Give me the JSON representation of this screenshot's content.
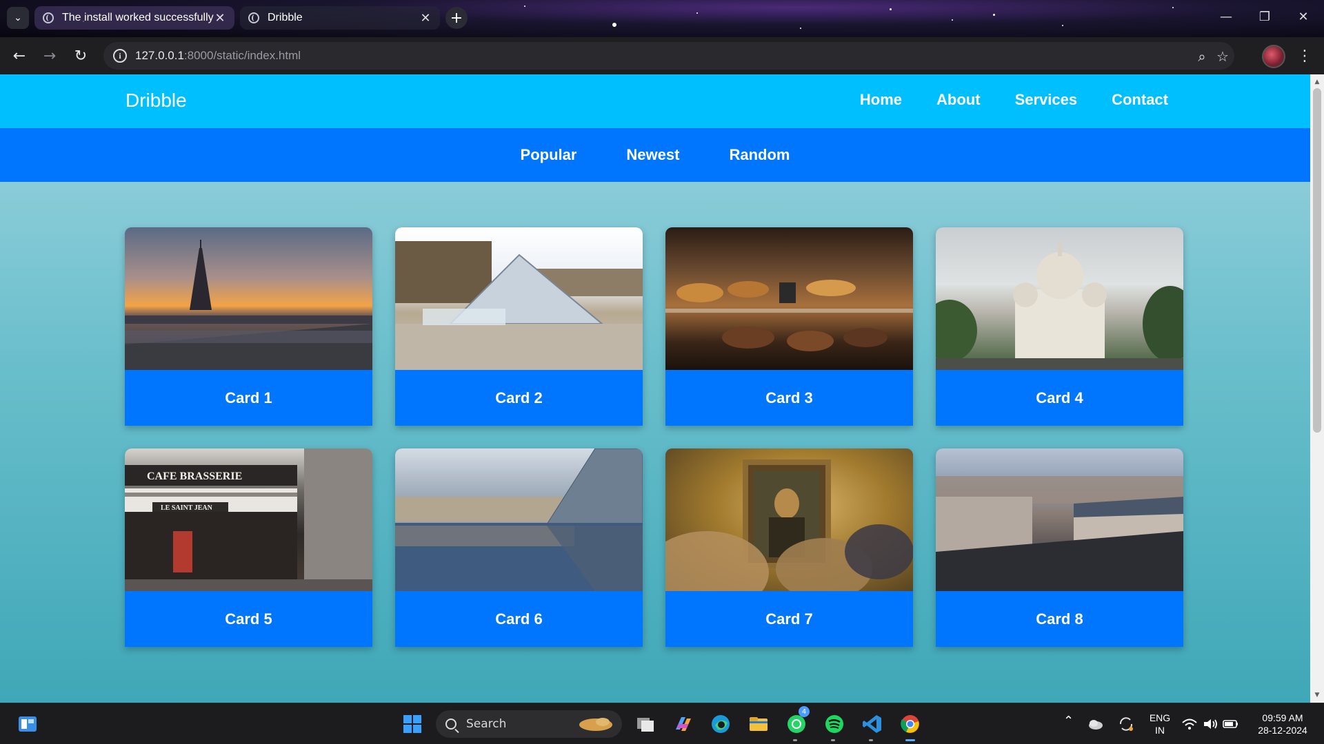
{
  "browser": {
    "tabs": [
      {
        "title": "The install worked successfully!",
        "close": "✕"
      },
      {
        "title": "Dribble",
        "close": "✕"
      }
    ],
    "new_tab": "+",
    "tab_menu": "⌄",
    "window": {
      "minimize": "—",
      "restore": "❐",
      "close": "✕"
    },
    "address": {
      "host": "127.0.0.1",
      "rest": ":8000/static/index.html"
    },
    "nav": {
      "back": "←",
      "forward": "→",
      "reload": "↻"
    },
    "zoom_icon": "⌕",
    "bookmark_icon": "☆",
    "menu_icon": "⋮"
  },
  "site": {
    "brand": "Dribble",
    "nav": [
      "Home",
      "About",
      "Services",
      "Contact"
    ],
    "subnav": [
      "Popular",
      "Newest",
      "Random"
    ],
    "cards": [
      {
        "label": "Card 1",
        "subject": "eiffel-tower-sunset"
      },
      {
        "label": "Card 2",
        "subject": "louvre-pyramid"
      },
      {
        "label": "Card 3",
        "subject": "bakery-pastries"
      },
      {
        "label": "Card 4",
        "subject": "sacre-coeur"
      },
      {
        "label": "Card 5",
        "subject": "cafe-brasserie"
      },
      {
        "label": "Card 6",
        "subject": "louvre-reflection"
      },
      {
        "label": "Card 7",
        "subject": "mona-lisa"
      },
      {
        "label": "Card 8",
        "subject": "paris-rooftops"
      }
    ]
  },
  "taskbar": {
    "search_label": "Search",
    "whatsapp_badge": "4",
    "tray": {
      "lang_top": "ENG",
      "lang_bottom": "IN",
      "time": "09:59 AM",
      "date": "28-12-2024",
      "chevron": "⌃"
    }
  },
  "colors": {
    "header": "#00bfff",
    "subnav": "#0076ff",
    "card_caption": "#0076ff"
  }
}
